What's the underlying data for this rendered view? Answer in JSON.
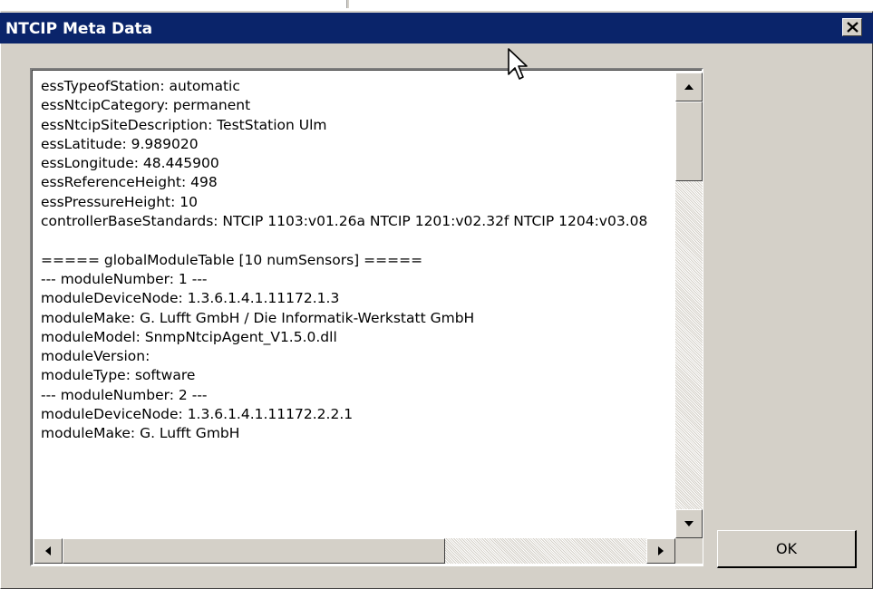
{
  "dialog": {
    "title": "NTCIP Meta Data",
    "ok_label": "OK"
  },
  "content": {
    "lines": [
      "essTypeofStation: automatic",
      "essNtcipCategory: permanent",
      "essNtcipSiteDescription: TestStation Ulm",
      "essLatitude: 9.989020",
      "essLongitude: 48.445900",
      "essReferenceHeight: 498",
      "essPressureHeight: 10",
      "controllerBaseStandards: NTCIP 1103:v01.26a NTCIP 1201:v02.32f NTCIP 1204:v03.08",
      "",
      "===== globalModuleTable [10 numSensors] =====",
      "--- moduleNumber: 1 ---",
      "moduleDeviceNode: 1.3.6.1.4.1.11172.1.3",
      "moduleMake: G. Lufft GmbH / Die Informatik-Werkstatt GmbH",
      "moduleModel: SnmpNtcipAgent_V1.5.0.dll",
      "moduleVersion:",
      "moduleType: software",
      "--- moduleNumber: 2 ---",
      "moduleDeviceNode: 1.3.6.1.4.1.11172.2.2.1",
      "moduleMake: G. Lufft GmbH"
    ]
  },
  "colors": {
    "titlebar": "#0a246a",
    "dialog_bg": "#d4d0c8"
  },
  "icons": {
    "close": "close-icon",
    "scroll_up": "arrow-up-icon",
    "scroll_down": "arrow-down-icon",
    "scroll_left": "arrow-left-icon",
    "scroll_right": "arrow-right-icon",
    "cursor": "mouse-pointer-icon"
  }
}
